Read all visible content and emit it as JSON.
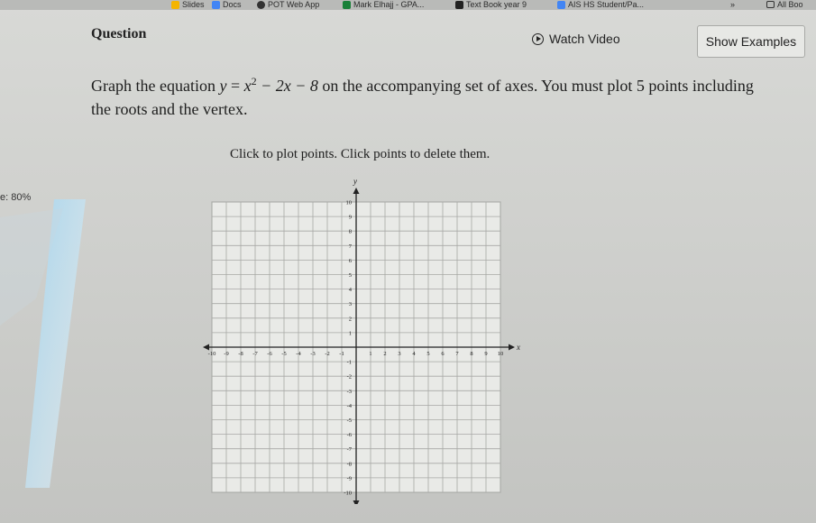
{
  "bookmarks": [
    {
      "label": "Slides",
      "color": "#f4b400"
    },
    {
      "label": "Docs",
      "color": "#4285f4"
    },
    {
      "label": "POT Web App",
      "color": "#333333"
    },
    {
      "label": "Mark Elhajj - GPA...",
      "color": "#188038"
    },
    {
      "label": "Text Book year 9",
      "color": "#222222"
    },
    {
      "label": "AIS HS Student/Pa...",
      "color": "#4285f4"
    },
    {
      "label": "»",
      "color": ""
    },
    {
      "label": "All Boo",
      "color": ""
    }
  ],
  "question": {
    "label": "Question",
    "watch_video": "Watch Video",
    "show_examples": "Show Examples",
    "text_before": "Graph the equation ",
    "equation_y": "y",
    "equation_eq": " = ",
    "equation_x": "x",
    "equation_exp": "2",
    "equation_rest": " − 2x − 8",
    "text_after": " on the accompanying set of axes. You must plot 5 points including the roots and the vertex.",
    "instructions": "Click to plot points. Click points to delete them."
  },
  "side_text": "e: 80%",
  "graph": {
    "x_axis_label": "x",
    "y_axis_label": "y",
    "xlim": [
      -10,
      10
    ],
    "ylim": [
      -10,
      10
    ],
    "x_ticks": [
      "-10",
      "-9",
      "-8",
      "-7",
      "-6",
      "-5",
      "-4",
      "-3",
      "-2",
      "-1",
      "1",
      "2",
      "3",
      "4",
      "5",
      "6",
      "7",
      "8",
      "9",
      "10"
    ],
    "y_ticks": [
      "10",
      "9",
      "8",
      "7",
      "6",
      "5",
      "4",
      "3",
      "2",
      "1",
      "-1",
      "-2",
      "-3",
      "-4",
      "-5",
      "-6",
      "-7",
      "-8",
      "-9",
      "-10"
    ]
  }
}
